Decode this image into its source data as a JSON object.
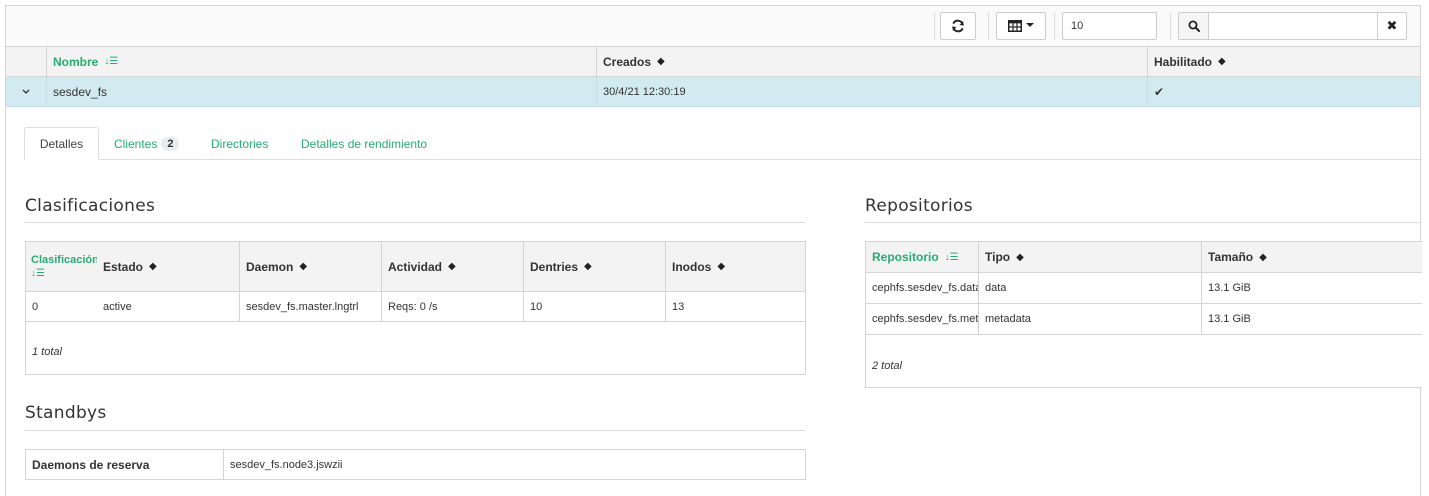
{
  "toolbar": {
    "refresh_icon": "refresh-icon",
    "columns_icon": "columns-icon",
    "page_size": "10",
    "search_icon": "search-icon",
    "search_placeholder": "",
    "clear_icon": "close-icon"
  },
  "grid": {
    "columns": [
      "Nombre",
      "Creados",
      "Habilitado"
    ],
    "rows": [
      {
        "name": "sesdev_fs",
        "created": "30/4/21 12:30:19",
        "enabled": "✔"
      }
    ]
  },
  "tabs": [
    {
      "label": "Detalles",
      "active": true
    },
    {
      "label": "Clientes",
      "badge": "2"
    },
    {
      "label": "Directories"
    },
    {
      "label": "Detalles de rendimiento"
    }
  ],
  "ranks": {
    "title": "Clasificaciones",
    "columns": [
      "Clasificación",
      "Estado",
      "Daemon",
      "Actividad",
      "Dentries",
      "Inodos"
    ],
    "rows": [
      [
        "0",
        "active",
        "sesdev_fs.master.lngtrl",
        "Reqs: 0 /s",
        "10",
        "13"
      ]
    ],
    "footer": "1 total"
  },
  "standbys": {
    "title": "Standbys",
    "label": "Daemons de reserva",
    "value": "sesdev_fs.node3.jswzii"
  },
  "pools": {
    "title": "Repositorios",
    "columns": [
      "Repositorio",
      "Tipo",
      "Tamaño"
    ],
    "rows": [
      [
        "cephfs.sesdev_fs.data",
        "data",
        "13.1 GiB"
      ],
      [
        "cephfs.sesdev_fs.meta",
        "metadata",
        "13.1 GiB"
      ]
    ],
    "footer": "2 total"
  },
  "colors": {
    "accent": "#27ad72",
    "selected_row": "#d2ebf0"
  }
}
